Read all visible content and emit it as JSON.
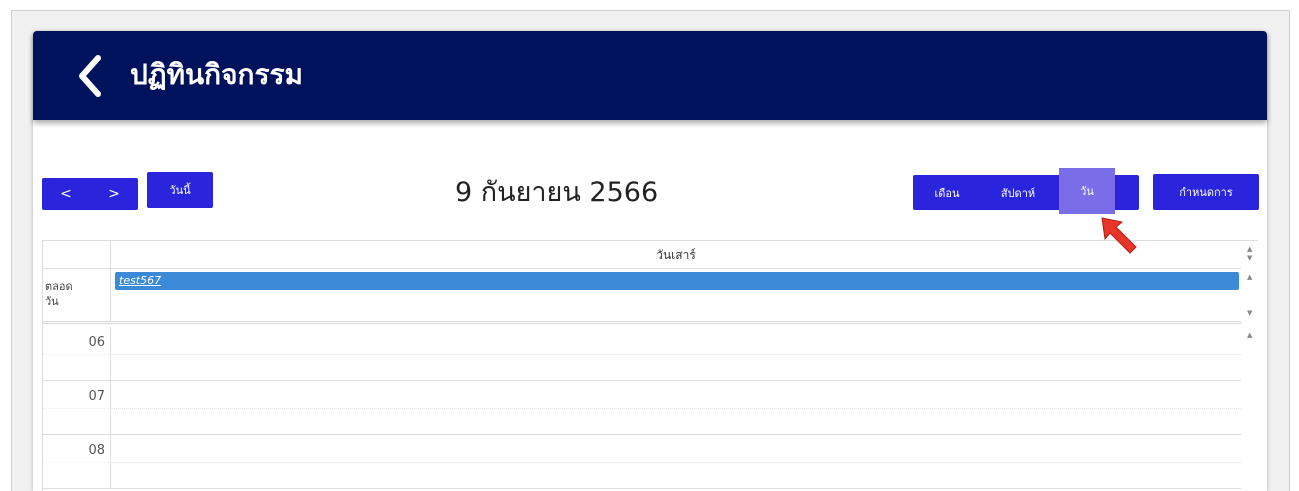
{
  "header": {
    "title": "ปฏิทินกิจกรรม",
    "back_icon": "chevron-left-icon",
    "bg_color": "#00125c"
  },
  "toolbar": {
    "prev_label": "<",
    "next_label": ">",
    "today_label": "วันนี้",
    "date_title": "9 กันยายน 2566",
    "views": [
      {
        "label": "เดือน",
        "active": false
      },
      {
        "label": "สัปดาห์",
        "active": false
      },
      {
        "label": "วัน",
        "active": true
      }
    ],
    "settings_label": "กำหนดการ",
    "accent_color": "#2a25dd"
  },
  "calendar": {
    "day_header": "วันเสาร์",
    "allday_label_line1": "ตลอด",
    "allday_label_line2": "วัน",
    "allday_events": [
      {
        "title": "test567",
        "color": "#3a8ad8"
      }
    ],
    "hours": [
      "06",
      "07",
      "08"
    ]
  }
}
